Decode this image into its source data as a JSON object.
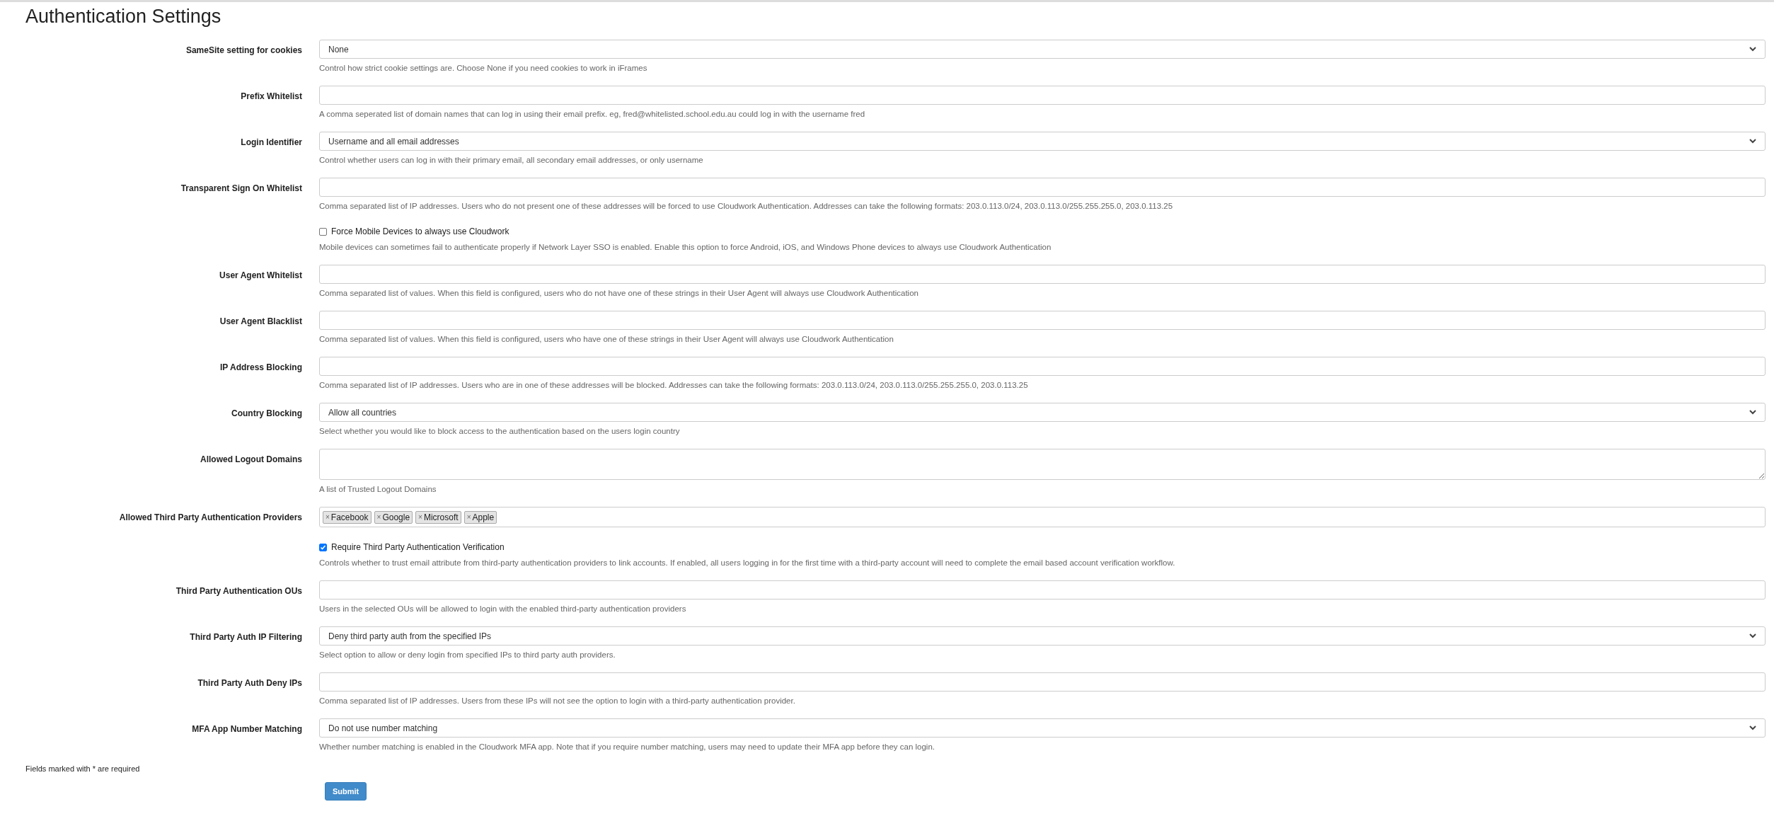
{
  "title": "Authentication Settings",
  "fields": [
    {
      "kind": "select",
      "label": "SameSite setting for cookies",
      "value": "None",
      "help": "Control how strict cookie settings are. Choose None if you need cookies to work in iFrames"
    },
    {
      "kind": "text",
      "label": "Prefix Whitelist",
      "help": "A comma seperated list of domain names that can log in using their email prefix. eg, fred@whitelisted.school.edu.au could log in with the username fred"
    },
    {
      "kind": "select",
      "label": "Login Identifier",
      "value": "Username and all email addresses",
      "help": "Control whether users can log in with their primary email, all secondary email addresses, or only username"
    },
    {
      "kind": "text",
      "label": "Transparent Sign On Whitelist",
      "help": "Comma separated list of IP addresses. Users who do not present one of these addresses will be forced to use Cloudwork Authentication. Addresses can take the following formats: 203.0.113.0/24, 203.0.113.0/255.255.255.0, 203.0.113.25"
    },
    {
      "kind": "checkbox",
      "text": "Force Mobile Devices to always use Cloudwork",
      "checked": false,
      "help": "Mobile devices can sometimes fail to authenticate properly if Network Layer SSO is enabled. Enable this option to force Android, iOS, and Windows Phone devices to always use Cloudwork Authentication"
    },
    {
      "kind": "text",
      "label": "User Agent Whitelist",
      "help": "Comma separated list of values. When this field is configured, users who do not have one of these strings in their User Agent will always use Cloudwork Authentication"
    },
    {
      "kind": "text",
      "label": "User Agent Blacklist",
      "help": "Comma separated list of values. When this field is configured, users who have one of these strings in their User Agent will always use Cloudwork Authentication"
    },
    {
      "kind": "text",
      "label": "IP Address Blocking",
      "help": "Comma separated list of IP addresses. Users who are in one of these addresses will be blocked. Addresses can take the following formats: 203.0.113.0/24, 203.0.113.0/255.255.255.0, 203.0.113.25"
    },
    {
      "kind": "select",
      "label": "Country Blocking",
      "value": "Allow all countries",
      "help": "Select whether you would like to block access to the authentication based on the users login country"
    },
    {
      "kind": "textarea",
      "label": "Allowed Logout Domains",
      "help": "A list of Trusted Logout Domains"
    },
    {
      "kind": "tags",
      "label": "Allowed Third Party Authentication Providers",
      "tags": [
        {
          "remove": "×",
          "text": "Facebook"
        },
        {
          "remove": "×",
          "text": "Google"
        },
        {
          "remove": "×",
          "text": "Microsoft"
        },
        {
          "remove": "×",
          "text": "Apple"
        }
      ]
    },
    {
      "kind": "checkbox",
      "text": "Require Third Party Authentication Verification",
      "checked": true,
      "help": "Controls whether to trust email attribute from third-party authentication providers to link accounts. If enabled, all users logging in for the first time with a third-party account will need to complete the email based account verification workflow."
    },
    {
      "kind": "text",
      "label": "Third Party Authentication OUs",
      "help": "Users in the selected OUs will be allowed to login with the enabled third-party authentication providers"
    },
    {
      "kind": "select",
      "label": "Third Party Auth IP Filtering",
      "value": "Deny third party auth from the specified IPs",
      "help": "Select option to allow or deny login from specified IPs to third party auth providers."
    },
    {
      "kind": "text",
      "label": "Third Party Auth Deny IPs",
      "help": "Comma separated list of IP addresses. Users from these IPs will not see the option to login with a third-party authentication provider."
    },
    {
      "kind": "select",
      "label": "MFA App Number Matching",
      "value": "Do not use number matching",
      "help": "Whether number matching is enabled in the Cloudwork MFA app. Note that if you require number matching, users may need to update their MFA app before they can login."
    }
  ],
  "footer_note": "Fields marked with * are required",
  "submit": "Submit"
}
